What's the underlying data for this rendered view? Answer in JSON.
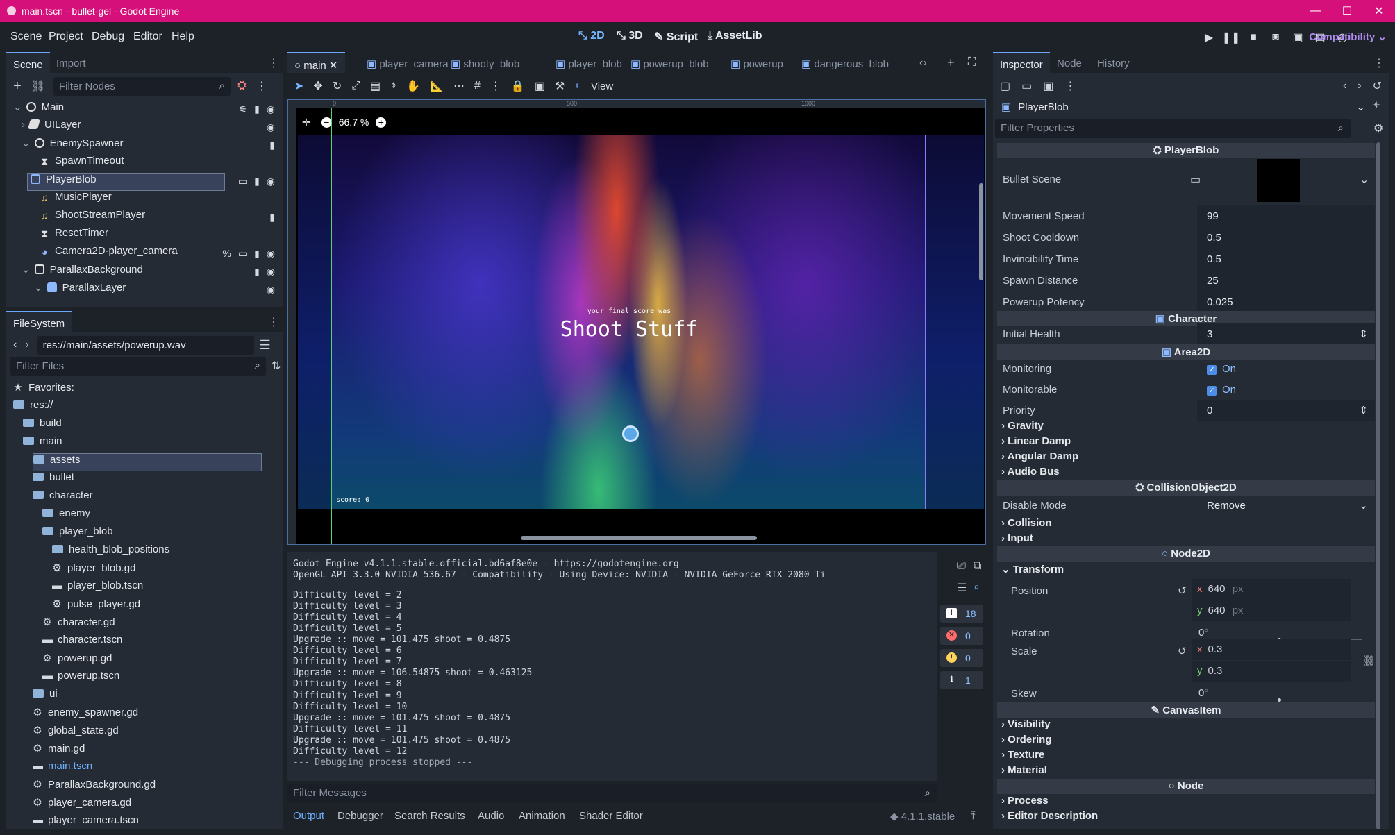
{
  "window": {
    "title": "main.tscn - bullet-gel - Godot Engine",
    "controls": [
      "—",
      "☐",
      "✕"
    ]
  },
  "menu": [
    "Scene",
    "Project",
    "Debug",
    "Editor",
    "Help"
  ],
  "modes": [
    "2D",
    "3D",
    "Script",
    "AssetLib"
  ],
  "renderer": "Compatibility",
  "scene_dock": {
    "tabs": [
      "Scene",
      "Import"
    ],
    "filter_placeholder": "Filter Nodes",
    "nodes": [
      {
        "label": "Main",
        "icon_color": "#e0e0e0"
      },
      {
        "label": "UILayer",
        "icon_color": "#e0e0e0"
      },
      {
        "label": "EnemySpawner",
        "icon_color": "#e0e0e0"
      },
      {
        "label": "SpawnTimeout",
        "icon_color": "#e0e0e0"
      },
      {
        "label": "PlayerBlob",
        "icon_color": "#8eb8ff"
      },
      {
        "label": "MusicPlayer",
        "icon_color": "#e0c26a"
      },
      {
        "label": "ShootStreamPlayer",
        "icon_color": "#e0c26a"
      },
      {
        "label": "ResetTimer",
        "icon_color": "#e0e0e0"
      },
      {
        "label": "Camera2D-player_camera",
        "icon_color": "#8eb8ff"
      },
      {
        "label": "ParallaxBackground",
        "icon_color": "#e0e0e0"
      },
      {
        "label": "ParallaxLayer",
        "icon_color": "#8eb8ff"
      }
    ]
  },
  "filesystem": {
    "tab": "FileSystem",
    "path": "res://main/assets/powerup.wav",
    "filter_placeholder": "Filter Files",
    "items": [
      {
        "label": "Favorites:",
        "type": "star",
        "level": 0
      },
      {
        "label": "res://",
        "type": "folder",
        "level": 0
      },
      {
        "label": "build",
        "type": "folder",
        "level": 1
      },
      {
        "label": "main",
        "type": "folder",
        "level": 1
      },
      {
        "label": "assets",
        "type": "folder",
        "level": 2
      },
      {
        "label": "bullet",
        "type": "folder",
        "level": 2
      },
      {
        "label": "character",
        "type": "folder",
        "level": 2
      },
      {
        "label": "enemy",
        "type": "folder",
        "level": 3
      },
      {
        "label": "player_blob",
        "type": "folder",
        "level": 3
      },
      {
        "label": "health_blob_positions",
        "type": "folder",
        "level": 4
      },
      {
        "label": "player_blob.gd",
        "type": "gear",
        "level": 4
      },
      {
        "label": "player_blob.tscn",
        "type": "scene",
        "level": 4
      },
      {
        "label": "pulse_player.gd",
        "type": "gear",
        "level": 4
      },
      {
        "label": "character.gd",
        "type": "gear",
        "level": 3
      },
      {
        "label": "character.tscn",
        "type": "scene",
        "level": 3
      },
      {
        "label": "powerup.gd",
        "type": "gear",
        "level": 3
      },
      {
        "label": "powerup.tscn",
        "type": "scene",
        "level": 3
      },
      {
        "label": "ui",
        "type": "folder",
        "level": 2
      },
      {
        "label": "enemy_spawner.gd",
        "type": "gear",
        "level": 2
      },
      {
        "label": "global_state.gd",
        "type": "gear",
        "level": 2
      },
      {
        "label": "main.gd",
        "type": "gear",
        "level": 2
      },
      {
        "label": "main.tscn",
        "type": "scene",
        "level": 2
      },
      {
        "label": "ParallaxBackground.gd",
        "type": "gear",
        "level": 2
      },
      {
        "label": "player_camera.gd",
        "type": "gear",
        "level": 2
      },
      {
        "label": "player_camera.tscn",
        "type": "scene",
        "level": 2
      }
    ]
  },
  "editor_tabs": [
    "main",
    "player_camera",
    "shooty_blob",
    "player_blob",
    "powerup_blob",
    "powerup",
    "dangerous_blob"
  ],
  "viewport": {
    "view_label": "View",
    "zoom": "66.7 %",
    "ruler_labels": [
      "0",
      "500",
      "1000"
    ],
    "game_subtitle": "your final score was",
    "game_title": "Shoot Stuff",
    "score": "score: 0"
  },
  "output": {
    "lines": [
      "Godot Engine v4.1.1.stable.official.bd6af8e0e - https://godotengine.org",
      "OpenGL API 3.3.0 NVIDIA 536.67 - Compatibility - Using Device: NVIDIA - NVIDIA GeForce RTX 2080 Ti",
      "",
      "Difficulty level = 2",
      "Difficulty level = 3",
      "Difficulty level = 4",
      "Difficulty level = 5",
      "Upgrade :: move = 101.475 shoot = 0.4875",
      "Difficulty level = 6",
      "Difficulty level = 7",
      "Upgrade :: move = 106.54875 shoot = 0.463125",
      "Difficulty level = 8",
      "Difficulty level = 9",
      "Difficulty level = 10",
      "Upgrade :: move = 101.475 shoot = 0.4875",
      "Difficulty level = 11",
      "Upgrade :: move = 101.475 shoot = 0.4875",
      "Difficulty level = 12",
      "--- Debugging process stopped ---"
    ],
    "filter_placeholder": "Filter Messages",
    "counters": {
      "messages": "18",
      "errors": "0",
      "warnings": "0",
      "info": "1"
    },
    "bottom_tabs": [
      "Output",
      "Debugger",
      "Search Results",
      "Audio",
      "Animation",
      "Shader Editor"
    ],
    "version": "4.1.1.stable"
  },
  "inspector": {
    "tabs": [
      "Inspector",
      "Node",
      "History"
    ],
    "object": "PlayerBlob",
    "filter_placeholder": "Filter Properties",
    "script_section": "PlayerBlob",
    "bullet_scene_label": "Bullet Scene",
    "props": [
      {
        "label": "Movement Speed",
        "value": "99"
      },
      {
        "label": "Shoot Cooldown",
        "value": "0.5"
      },
      {
        "label": "Invincibility Time",
        "value": "0.5"
      },
      {
        "label": "Spawn Distance",
        "value": "25"
      },
      {
        "label": "Powerup Potency",
        "value": "0.025"
      }
    ],
    "character_section": "Character",
    "initial_health": {
      "label": "Initial Health",
      "value": "3"
    },
    "area_section": "Area2D",
    "monitoring": {
      "label": "Monitoring",
      "value": "On"
    },
    "monitorable": {
      "label": "Monitorable",
      "value": "On"
    },
    "priority": {
      "label": "Priority",
      "value": "0"
    },
    "area_groups": [
      "Gravity",
      "Linear Damp",
      "Angular Damp",
      "Audio Bus"
    ],
    "collision_section": "CollisionObject2D",
    "disable_mode": {
      "label": "Disable Mode",
      "value": "Remove"
    },
    "collision_groups": [
      "Collision",
      "Input"
    ],
    "node2d_section": "Node2D",
    "transform_group": "Transform",
    "position": {
      "label": "Position",
      "x": "640",
      "y": "640",
      "unit": "px"
    },
    "rotation": {
      "label": "Rotation",
      "value": "0",
      "unit": "°"
    },
    "scale": {
      "label": "Scale",
      "x": "0.3",
      "y": "0.3"
    },
    "skew": {
      "label": "Skew",
      "value": "0",
      "unit": "°"
    },
    "canvas_section": "CanvasItem",
    "canvas_groups": [
      "Visibility",
      "Ordering",
      "Texture",
      "Material"
    ],
    "node_section": "Node",
    "node_groups": [
      "Process",
      "Editor Description"
    ]
  }
}
